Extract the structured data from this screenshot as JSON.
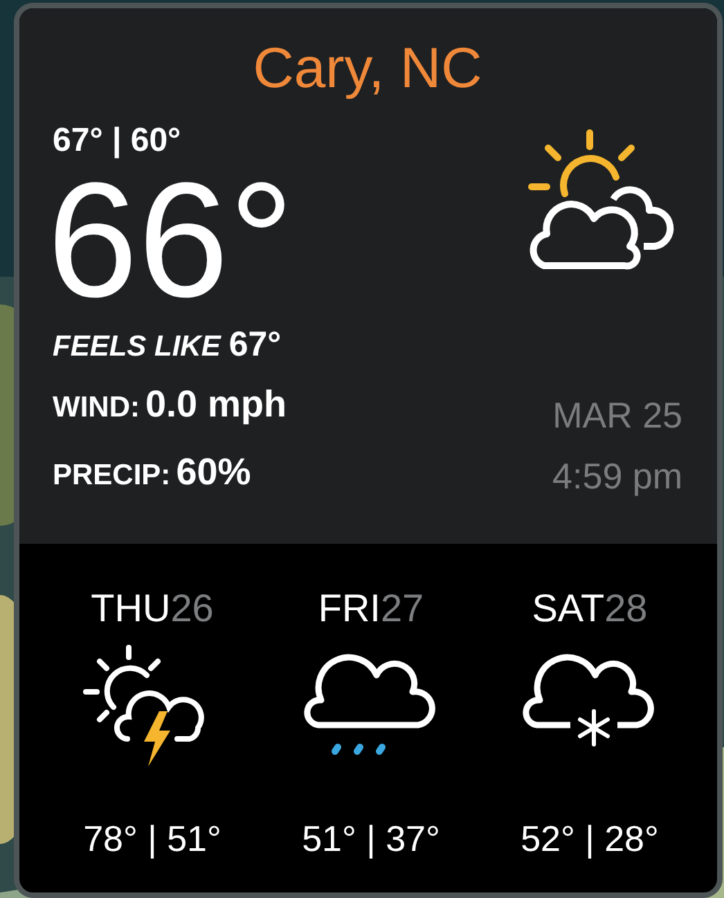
{
  "location": "Cary, NC",
  "today": {
    "high_low": "67° | 60°",
    "temperature": "66°",
    "condition": {
      "kind": "partly-cloudy"
    },
    "feels_like": {
      "label": "FEELS LIKE",
      "value": "67°"
    },
    "wind": {
      "label": "WIND:",
      "value": "0.0 mph"
    },
    "precip": {
      "label": "PRECIP:",
      "value": "60%"
    },
    "date": "MAR 25",
    "time": "4:59 pm"
  },
  "forecast": [
    {
      "weekday": "THU",
      "day": "26",
      "kind": "storm",
      "temps": "78° | 51°"
    },
    {
      "weekday": "FRI",
      "day": "27",
      "kind": "rain",
      "temps": "51° | 37°"
    },
    {
      "weekday": "SAT",
      "day": "28",
      "kind": "snow",
      "temps": "52° | 28°"
    }
  ]
}
